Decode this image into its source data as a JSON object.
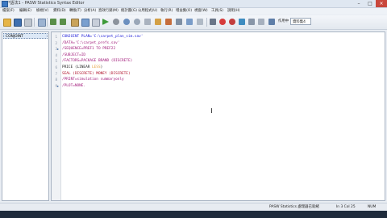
{
  "window": {
    "title": "*語法1 - PASW Statistics Syntax Editor",
    "controls": [
      "–",
      "□",
      "×"
    ]
  },
  "menu": [
    "檔案(F)",
    "編輯(E)",
    "檢視(V)",
    "資料(D)",
    "轉換(T)",
    "分析(A)",
    "直效行銷(M)",
    "統計圖(G)",
    "公用程式(U)",
    "執行(R)",
    "增益集(O)",
    "視窗(W)",
    "工具(S)",
    "說明(H)"
  ],
  "toolbar": {
    "active_label": "作用中",
    "dataset_combo": "資料集4"
  },
  "colors": {
    "keyword": "#1b1bd8",
    "subcommand": "#a11a7a",
    "value": "#222222",
    "paren_keyword": "#b0132b",
    "error": "#e7a03b"
  },
  "navigator": {
    "items": [
      "CONJOINT"
    ]
  },
  "editor": {
    "lines": [
      {
        "num": "1",
        "marker": "",
        "segments": [
          {
            "t": "CONJOINT PLAN='C:\\carpet_plan_sim.sav'",
            "c": "keyword"
          }
        ]
      },
      {
        "num": "2",
        "marker": "",
        "segments": [
          {
            "t": "/DATA='C:\\carpet_prefs.sav'",
            "c": "subcommand"
          }
        ]
      },
      {
        "num": "3",
        "marker": "▸",
        "segments": [
          {
            "t": "/SEQUENCE=PREF1 TO PREF22",
            "c": "subcommand"
          }
        ]
      },
      {
        "num": "4",
        "marker": "",
        "segments": [
          {
            "t": "/SUBJECT=ID",
            "c": "subcommand"
          }
        ]
      },
      {
        "num": "5",
        "marker": "",
        "segments": [
          {
            "t": "/FACTORS=PACKAGE BRAND (DISCRETE)",
            "c": "subcommand"
          }
        ]
      },
      {
        "num": "6",
        "marker": "",
        "segments": [
          {
            "t": "PRICE (LINEAR ",
            "c": "value"
          },
          {
            "t": "LESS",
            "c": "error"
          },
          {
            "t": ")",
            "c": "value"
          }
        ]
      },
      {
        "num": "7",
        "marker": "",
        "segments": [
          {
            "t": "SEAL (DISCRETE) MONEY (DISCRETE)",
            "c": "paren_keyword"
          }
        ]
      },
      {
        "num": "8",
        "marker": "",
        "segments": [
          {
            "t": "/PRINT=simulation summaryonly",
            "c": "subcommand"
          }
        ]
      },
      {
        "num": "9",
        "marker": "▸",
        "segments": [
          {
            "t": "/PLOT=NONE.",
            "c": "subcommand"
          }
        ]
      }
    ]
  },
  "status": {
    "processor": "PASW Statistics 處理器已就緒",
    "position": "In 3 Col 25",
    "mode": "NUM"
  }
}
